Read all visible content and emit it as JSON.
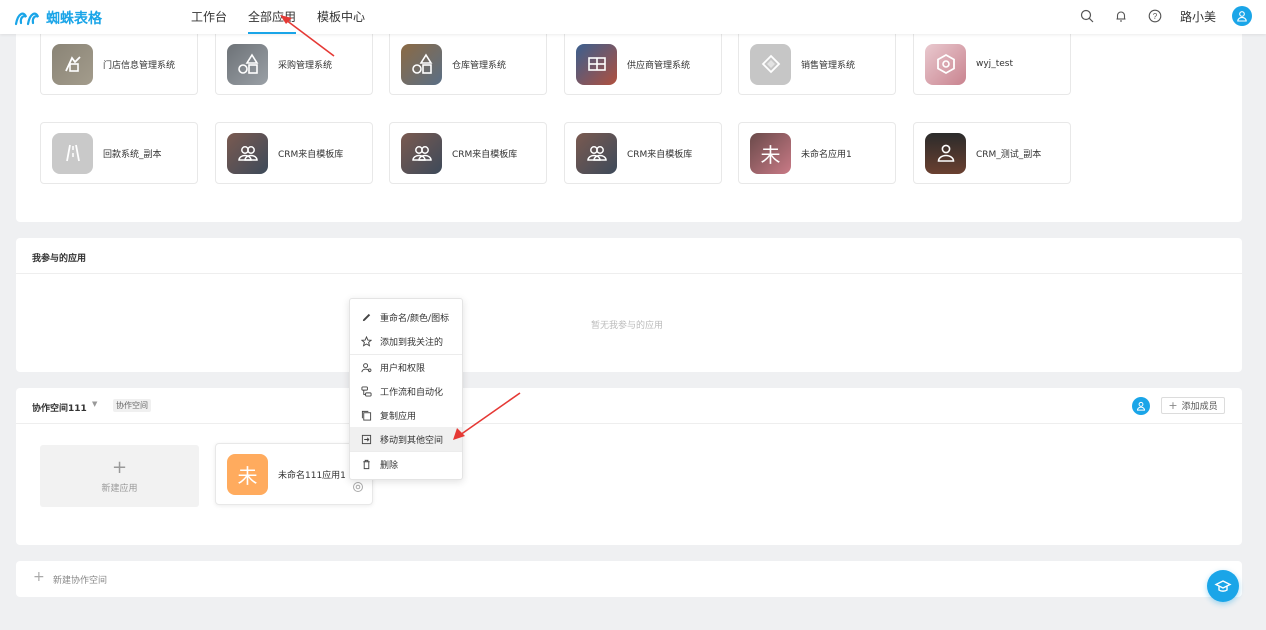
{
  "brand": {
    "name": "蜘蛛表格",
    "accent": "#1aa5e8"
  },
  "nav": [
    {
      "label": "工作台",
      "active": false
    },
    {
      "label": "全部应用",
      "active": true
    },
    {
      "label": "模板中心",
      "active": false
    }
  ],
  "topbar_right": {
    "icons": [
      "search-icon",
      "bell-icon",
      "help-icon"
    ],
    "username": "路小美"
  },
  "app_grid": {
    "row1": [
      {
        "name": "门店信息管理系统",
        "icon": "store-icon"
      },
      {
        "name": "采购管理系统",
        "icon": "shapes-icon"
      },
      {
        "name": "仓库管理系统",
        "icon": "shapes-icon"
      },
      {
        "name": "供应商管理系统",
        "icon": "grid-icon"
      },
      {
        "name": "销售管理系统",
        "icon": "handshake-icon"
      },
      {
        "name": "wyj_test",
        "icon": "hexagon-icon"
      }
    ],
    "row2": [
      {
        "name": "回款系统_副本",
        "icon": "road-icon"
      },
      {
        "name": "CRM来自模板库",
        "icon": "users-icon"
      },
      {
        "name": "CRM来自模板库",
        "icon": "users-icon"
      },
      {
        "name": "CRM来自模板库",
        "icon": "users-icon"
      },
      {
        "name": "未命名应用1",
        "icon": "text-icon",
        "icon_text": "未"
      },
      {
        "name": "CRM_测试_副本",
        "icon": "user-icon"
      }
    ]
  },
  "participated": {
    "title": "我参与的应用",
    "empty_text": "暂无我参与的应用"
  },
  "workspace": {
    "name": "协作空间111",
    "tag": "协作空间",
    "add_member_label": "添加成员",
    "new_app_label": "新建应用",
    "app": {
      "name": "未命名111应用1",
      "icon_text": "未",
      "color": "#ffab5e"
    }
  },
  "context_menu": [
    {
      "label": "重命名/颜色/图标",
      "icon": "pencil-icon"
    },
    {
      "label": "添加到我关注的",
      "icon": "star-icon"
    },
    {
      "label": "用户和权限",
      "icon": "user-permission-icon"
    },
    {
      "label": "工作流和自动化",
      "icon": "workflow-icon"
    },
    {
      "label": "复制应用",
      "icon": "copy-icon"
    },
    {
      "label": "移动到其他空间",
      "icon": "move-icon",
      "highlighted": true
    },
    {
      "label": "删除",
      "icon": "trash-icon"
    }
  ],
  "new_workspace_label": "新建协作空间"
}
